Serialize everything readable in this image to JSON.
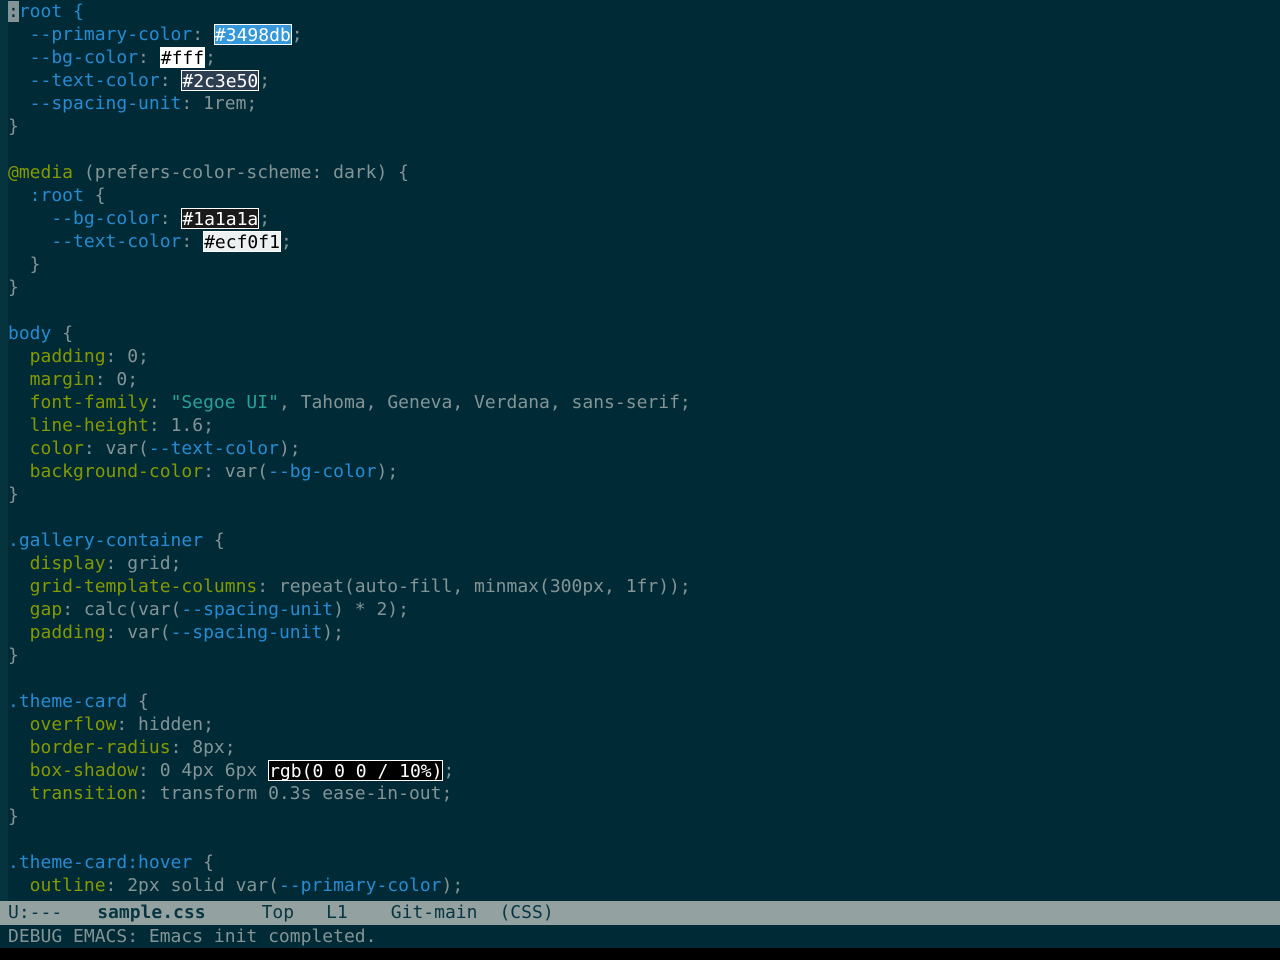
{
  "buffer": {
    "lines": [
      [
        {
          "t": ":",
          "c": "cursor"
        },
        {
          "t": "root {",
          "c": "sel"
        }
      ],
      [
        {
          "t": "  --primary-color",
          "c": "var"
        },
        {
          "t": ": "
        },
        {
          "t": "#3498db",
          "sw": "#3498db",
          "fg": "#ffffff"
        },
        {
          "t": ";"
        }
      ],
      [
        {
          "t": "  --bg-color",
          "c": "var"
        },
        {
          "t": ": "
        },
        {
          "t": "#fff",
          "sw": "#ffffff",
          "fg": "#000000"
        },
        {
          "t": ";"
        }
      ],
      [
        {
          "t": "  --text-color",
          "c": "var"
        },
        {
          "t": ": "
        },
        {
          "t": "#2c3e50",
          "sw": "#2c3e50",
          "fg": "#ffffff"
        },
        {
          "t": ";"
        }
      ],
      [
        {
          "t": "  --spacing-unit",
          "c": "var"
        },
        {
          "t": ": 1rem;"
        }
      ],
      [
        {
          "t": "}"
        }
      ],
      [
        {
          "t": ""
        }
      ],
      [
        {
          "t": "@media",
          "c": "at"
        },
        {
          "t": " (prefers-color-scheme: dark) {"
        }
      ],
      [
        {
          "t": "  :root",
          "c": "sel"
        },
        {
          "t": " {"
        }
      ],
      [
        {
          "t": "    --bg-color",
          "c": "var"
        },
        {
          "t": ": "
        },
        {
          "t": "#1a1a1a",
          "sw": "#1a1a1a",
          "fg": "#ffffff"
        },
        {
          "t": ";"
        }
      ],
      [
        {
          "t": "    --text-color",
          "c": "var"
        },
        {
          "t": ": "
        },
        {
          "t": "#ecf0f1",
          "sw": "#ecf0f1",
          "fg": "#000000"
        },
        {
          "t": ";"
        }
      ],
      [
        {
          "t": "  }"
        }
      ],
      [
        {
          "t": "}"
        }
      ],
      [
        {
          "t": ""
        }
      ],
      [
        {
          "t": "body",
          "c": "sel"
        },
        {
          "t": " {"
        }
      ],
      [
        {
          "t": "  padding",
          "c": "prop"
        },
        {
          "t": ": 0;"
        }
      ],
      [
        {
          "t": "  margin",
          "c": "prop"
        },
        {
          "t": ": 0;"
        }
      ],
      [
        {
          "t": "  font-family",
          "c": "prop"
        },
        {
          "t": ": "
        },
        {
          "t": "\"Segoe UI\"",
          "c": "str"
        },
        {
          "t": ", Tahoma, Geneva, Verdana, sans-serif;"
        }
      ],
      [
        {
          "t": "  line-height",
          "c": "prop"
        },
        {
          "t": ": 1.6;"
        }
      ],
      [
        {
          "t": "  color",
          "c": "prop"
        },
        {
          "t": ": var("
        },
        {
          "t": "--text-color",
          "c": "var"
        },
        {
          "t": ");"
        }
      ],
      [
        {
          "t": "  background-color",
          "c": "prop"
        },
        {
          "t": ": var("
        },
        {
          "t": "--bg-color",
          "c": "var"
        },
        {
          "t": ");"
        }
      ],
      [
        {
          "t": "}"
        }
      ],
      [
        {
          "t": ""
        }
      ],
      [
        {
          "t": ".gallery-container",
          "c": "sel"
        },
        {
          "t": " {"
        }
      ],
      [
        {
          "t": "  display",
          "c": "prop"
        },
        {
          "t": ": grid;"
        }
      ],
      [
        {
          "t": "  grid-template-columns",
          "c": "prop"
        },
        {
          "t": ": repeat(auto-fill, minmax(300px, 1fr));"
        }
      ],
      [
        {
          "t": "  gap",
          "c": "prop"
        },
        {
          "t": ": calc(var("
        },
        {
          "t": "--spacing-unit",
          "c": "var"
        },
        {
          "t": ") * 2);"
        }
      ],
      [
        {
          "t": "  padding",
          "c": "prop"
        },
        {
          "t": ": var("
        },
        {
          "t": "--spacing-unit",
          "c": "var"
        },
        {
          "t": ");"
        }
      ],
      [
        {
          "t": "}"
        }
      ],
      [
        {
          "t": ""
        }
      ],
      [
        {
          "t": ".theme-card",
          "c": "sel"
        },
        {
          "t": " {"
        }
      ],
      [
        {
          "t": "  overflow",
          "c": "prop"
        },
        {
          "t": ": hidden;"
        }
      ],
      [
        {
          "t": "  border-radius",
          "c": "prop"
        },
        {
          "t": ": 8px;"
        }
      ],
      [
        {
          "t": "  box-shadow",
          "c": "prop"
        },
        {
          "t": ": 0 4px 6px "
        },
        {
          "t": "rgb(0 0 0 / 10%)",
          "sw": "#000000",
          "fg": "#ffffff"
        },
        {
          "t": ";"
        }
      ],
      [
        {
          "t": "  transition",
          "c": "prop"
        },
        {
          "t": ": transform 0.3s ease-in-out;"
        }
      ],
      [
        {
          "t": "}"
        }
      ],
      [
        {
          "t": ""
        }
      ],
      [
        {
          "t": ".theme-card:hover",
          "c": "sel"
        },
        {
          "t": " {"
        }
      ],
      [
        {
          "t": "  outline",
          "c": "prop"
        },
        {
          "t": ": 2px solid var("
        },
        {
          "t": "--primary-color",
          "c": "var"
        },
        {
          "t": ");"
        }
      ]
    ]
  },
  "modeline": {
    "status": "U:---",
    "filename": "sample.css",
    "position": "Top",
    "line": "L1",
    "vcs": "Git-main",
    "mode": "(CSS)"
  },
  "minibuffer": {
    "message": "DEBUG EMACS: Emacs init completed."
  }
}
